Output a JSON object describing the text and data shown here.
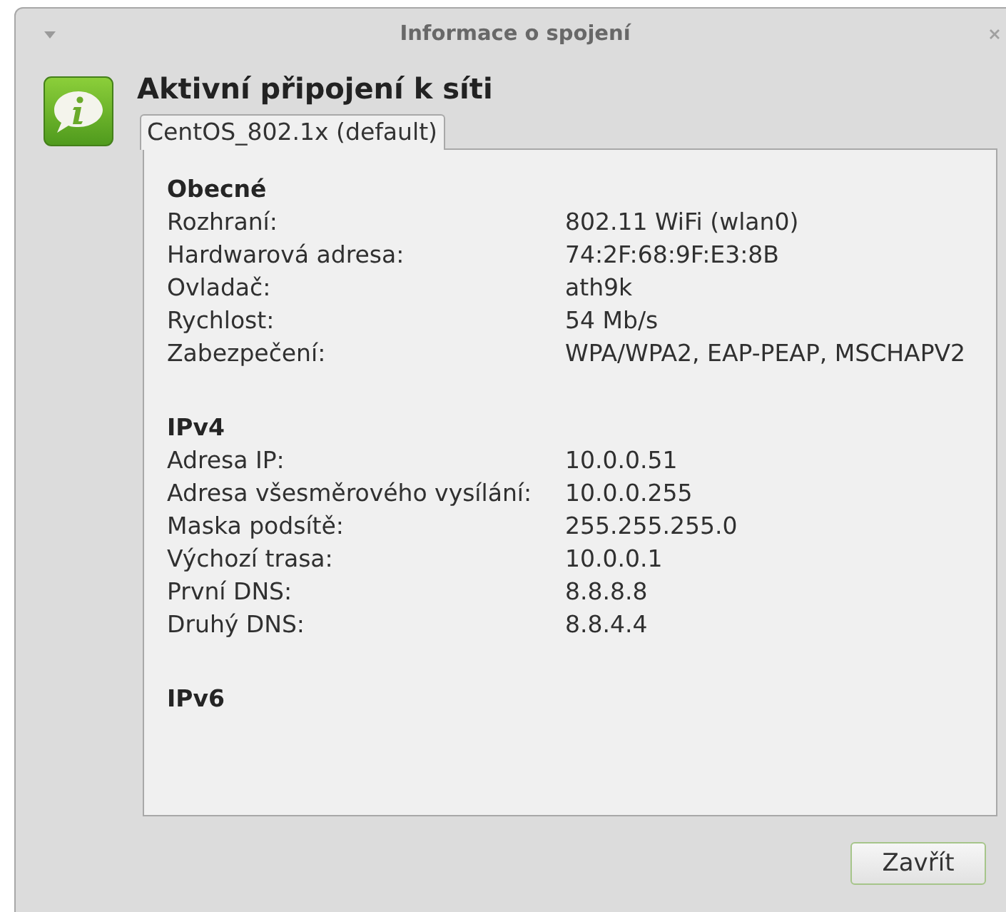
{
  "window": {
    "title": "Informace o spojení"
  },
  "heading": "Aktivní připojení k síti",
  "tabs": [
    {
      "label": "CentOS_802.1x (default)",
      "selected": true
    }
  ],
  "sections": [
    {
      "title": "Obecné",
      "rows": [
        {
          "label": "Rozhraní:",
          "value": "802.11 WiFi (wlan0)"
        },
        {
          "label": "Hardwarová adresa:",
          "value": "74:2F:68:9F:E3:8B"
        },
        {
          "label": "Ovladač:",
          "value": "ath9k"
        },
        {
          "label": "Rychlost:",
          "value": "54 Mb/s"
        },
        {
          "label": "Zabezpečení:",
          "value": "WPA/WPA2, EAP-PEAP, MSCHAPV2"
        }
      ]
    },
    {
      "title": "IPv4",
      "rows": [
        {
          "label": "Adresa IP:",
          "value": "10.0.0.51"
        },
        {
          "label": "Adresa všesměrového vysílání:",
          "value": "10.0.0.255"
        },
        {
          "label": "Maska podsítě:",
          "value": "255.255.255.0"
        },
        {
          "label": "Výchozí trasa:",
          "value": "10.0.0.1"
        },
        {
          "label": "První DNS:",
          "value": "8.8.8.8"
        },
        {
          "label": "Druhý DNS:",
          "value": "8.8.4.4"
        }
      ]
    },
    {
      "title": "IPv6"
    }
  ],
  "buttons": [
    "Zavřít"
  ]
}
